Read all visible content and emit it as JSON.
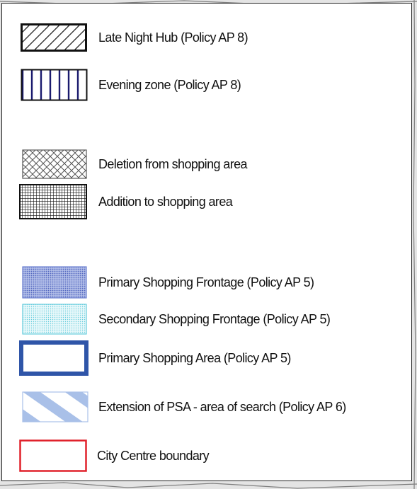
{
  "legend": {
    "items": [
      {
        "key": "late-night-hub",
        "label": "Late Night Hub (Policy AP 8)",
        "pattern": "diagonal-hatch",
        "color": "#111111"
      },
      {
        "key": "evening-zone",
        "label": "Evening zone (Policy AP 8)",
        "pattern": "vertical-stripes",
        "color": "#1a1a6e"
      },
      {
        "key": "deletion",
        "label": "Deletion from shopping area",
        "pattern": "cross-hatch",
        "color": "#555555"
      },
      {
        "key": "addition",
        "label": "Addition to shopping area",
        "pattern": "grid",
        "color": "#111111"
      },
      {
        "key": "primary-frontage",
        "label": "Primary Shopping Frontage  (Policy AP 5)",
        "pattern": "dense-dots",
        "color": "#6b7fd0"
      },
      {
        "key": "secondary-frontage",
        "label": "Secondary Shopping Frontage (Policy AP 5)",
        "pattern": "light-dots",
        "color": "#66ccdd"
      },
      {
        "key": "primary-area",
        "label": "Primary Shopping Area (Policy AP 5)",
        "pattern": "thick-outline",
        "color": "#2f55a8"
      },
      {
        "key": "psa-extension",
        "label": "Extension of PSA - area of search (Policy AP 6)",
        "pattern": "wide-diagonal-stripes",
        "color": "#a9c0e8"
      },
      {
        "key": "city-centre",
        "label": "City Centre boundary",
        "pattern": "outline",
        "color": "#e0202a"
      }
    ]
  }
}
